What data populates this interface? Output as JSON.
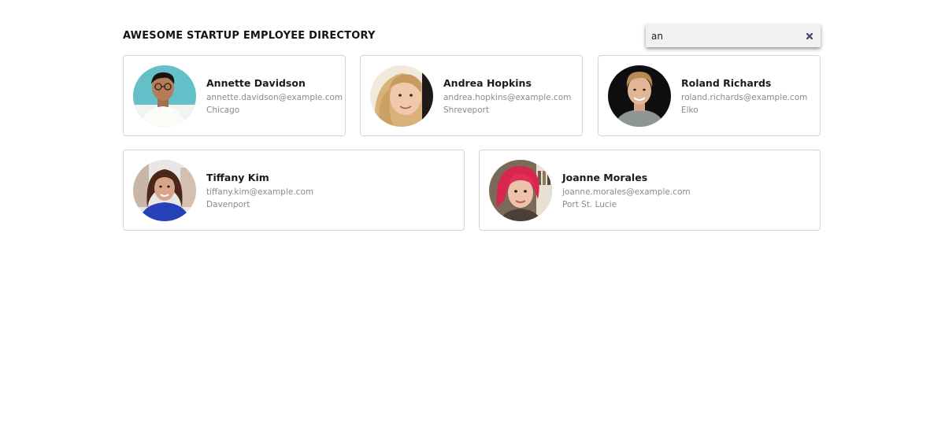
{
  "header": {
    "title": "AWESOME STARTUP EMPLOYEE DIRECTORY"
  },
  "search": {
    "value": "an",
    "placeholder": ""
  },
  "employees": [
    {
      "name": "Annette Davidson",
      "email": "annette.davidson@example.com",
      "city": "Chicago"
    },
    {
      "name": "Andrea Hopkins",
      "email": "andrea.hopkins@example.com",
      "city": "Shreveport"
    },
    {
      "name": "Roland Richards",
      "email": "roland.richards@example.com",
      "city": "Elko"
    },
    {
      "name": "Tiffany Kim",
      "email": "tiffany.kim@example.com",
      "city": "Davenport"
    },
    {
      "name": "Joanne Morales",
      "email": "joanne.morales@example.com",
      "city": "Port St. Lucie"
    }
  ],
  "icons": {
    "clear": "close-icon"
  },
  "colors": {
    "accent": "#3b4a6b",
    "card_border": "#d4d4d4",
    "muted_text": "#8a8a8a"
  }
}
